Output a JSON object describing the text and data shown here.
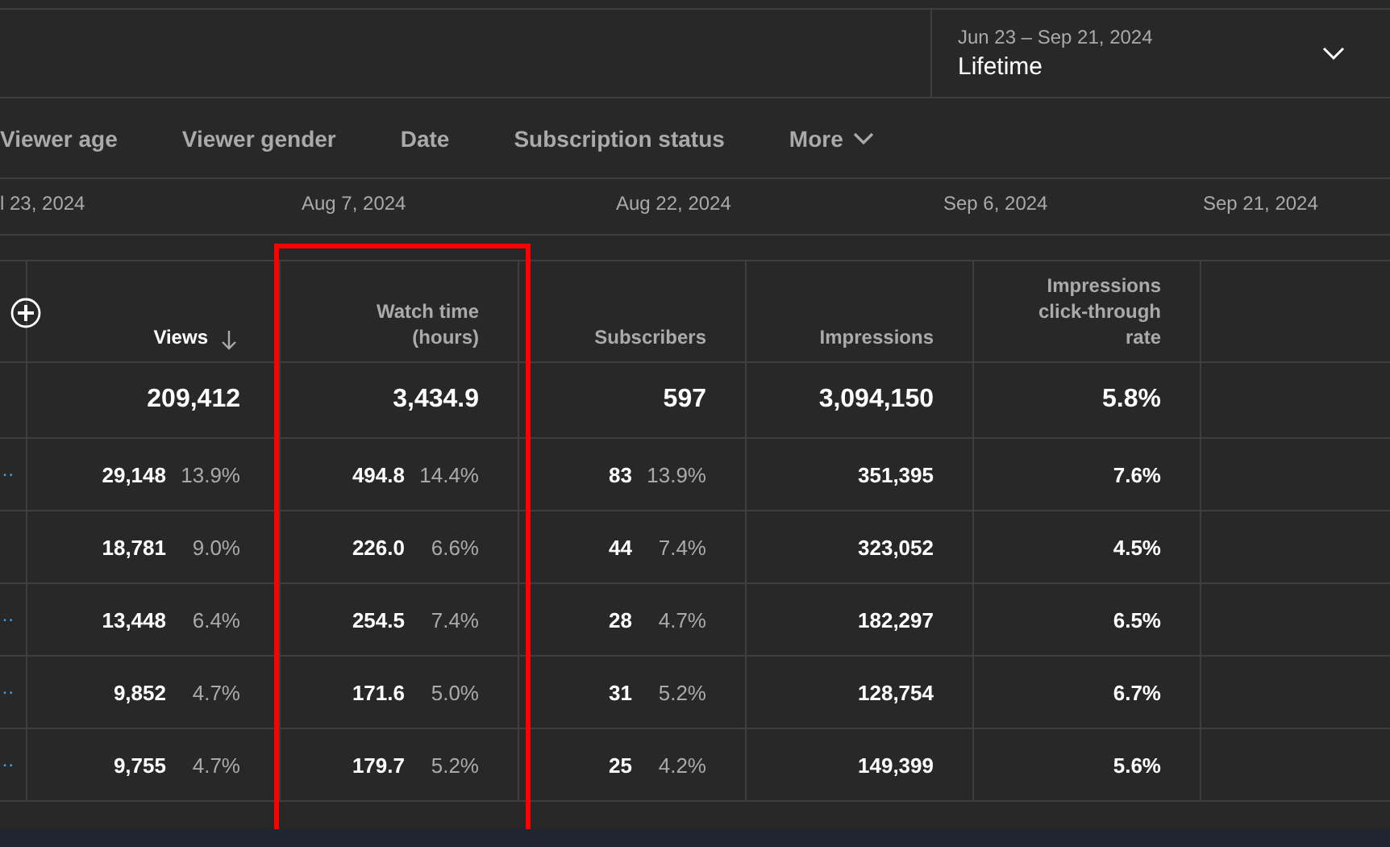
{
  "date_picker": {
    "range": "Jun 23 – Sep 21, 2024",
    "period": "Lifetime"
  },
  "tabs": [
    {
      "label": "Viewer age",
      "selected": false
    },
    {
      "label": "Viewer gender",
      "selected": false
    },
    {
      "label": "Date",
      "selected": false
    },
    {
      "label": "Subscription status",
      "selected": false
    },
    {
      "label": "More",
      "selected": false,
      "kind": "dropdown"
    }
  ],
  "chart_axis": {
    "labels": [
      "l 23, 2024",
      "Aug 7, 2024",
      "Aug 22, 2024",
      "Sep 6, 2024",
      "Sep 21, 2024"
    ]
  },
  "table": {
    "columns": [
      {
        "label": "Views",
        "sorted": true,
        "highlighted": false
      },
      {
        "label": "Watch time (hours)",
        "sorted": false,
        "highlighted": true
      },
      {
        "label": "Subscribers",
        "sorted": false
      },
      {
        "label": "Impressions",
        "sorted": false
      },
      {
        "label": "Impressions click-through rate",
        "sorted": false
      }
    ],
    "totals": [
      "209,412",
      "3,434.9",
      "597",
      "3,094,150",
      "5.8%"
    ],
    "rows": [
      {
        "title_tail": "…",
        "cells": [
          {
            "value": "29,148",
            "share": "13.9%"
          },
          {
            "value": "494.8",
            "share": "14.4%"
          },
          {
            "value": "83",
            "share": "13.9%"
          },
          {
            "value": "351,395"
          },
          {
            "value": "7.6%"
          }
        ]
      },
      {
        "cells": [
          {
            "value": "18,781",
            "share": "9.0%"
          },
          {
            "value": "226.0",
            "share": "6.6%"
          },
          {
            "value": "44",
            "share": "7.4%"
          },
          {
            "value": "323,052"
          },
          {
            "value": "4.5%"
          }
        ]
      },
      {
        "title_tail": "…",
        "cells": [
          {
            "value": "13,448",
            "share": "6.4%"
          },
          {
            "value": "254.5",
            "share": "7.4%"
          },
          {
            "value": "28",
            "share": "4.7%"
          },
          {
            "value": "182,297"
          },
          {
            "value": "6.5%"
          }
        ]
      },
      {
        "title_tail": "…",
        "cells": [
          {
            "value": "9,852",
            "share": "4.7%"
          },
          {
            "value": "171.6",
            "share": "5.0%"
          },
          {
            "value": "31",
            "share": "5.2%"
          },
          {
            "value": "128,754"
          },
          {
            "value": "6.7%"
          }
        ]
      },
      {
        "title_tail": "…",
        "cells": [
          {
            "value": "9,755",
            "share": "4.7%"
          },
          {
            "value": "179.7",
            "share": "5.2%"
          },
          {
            "value": "25",
            "share": "4.2%"
          },
          {
            "value": "149,399"
          },
          {
            "value": "5.6%"
          }
        ]
      }
    ]
  }
}
